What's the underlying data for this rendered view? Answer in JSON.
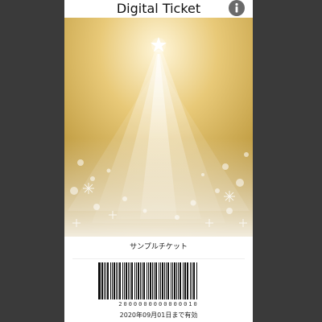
{
  "header": {
    "title": "Digital Ticket",
    "info_icon": "info-icon"
  },
  "ticket": {
    "name": "サンプルチケット",
    "barcode_number": "2000000000000010",
    "valid_until": "2020年09月01日まで有効"
  },
  "colors": {
    "background": "#3a3a3a",
    "hero_gold": "#c9a23d",
    "hero_light": "#fff6d9"
  }
}
